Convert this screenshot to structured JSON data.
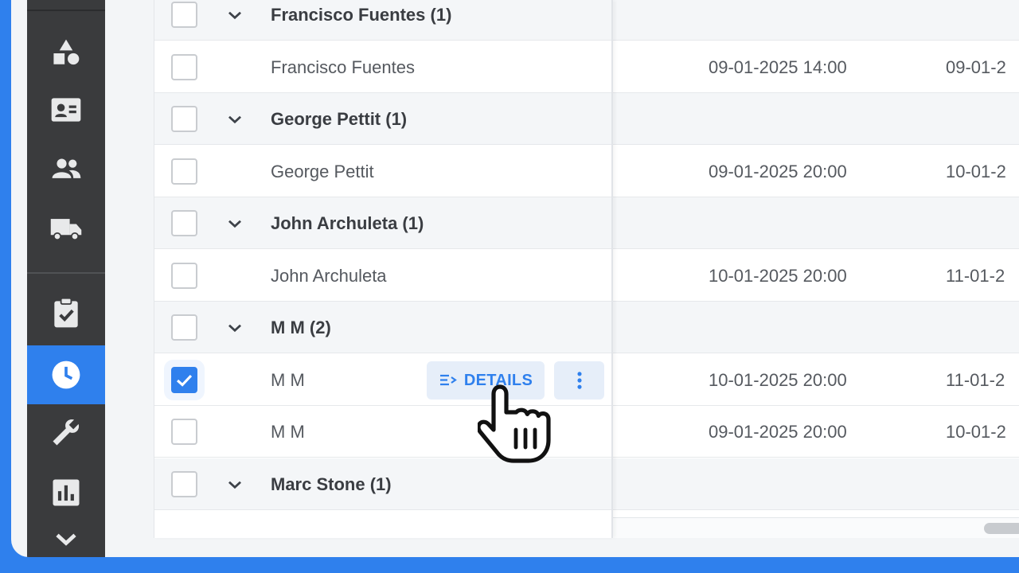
{
  "sidebar": {
    "items": [
      {
        "icon": "shapes-icon",
        "active": false
      },
      {
        "icon": "contact-card-icon",
        "active": false
      },
      {
        "icon": "people-icon",
        "active": false
      },
      {
        "icon": "truck-icon",
        "active": false
      },
      {
        "icon": "clipboard-check-icon",
        "active": false
      },
      {
        "icon": "clock-icon",
        "active": true
      },
      {
        "icon": "wrench-icon",
        "active": false
      },
      {
        "icon": "bar-chart-icon",
        "active": false
      },
      {
        "icon": "chevron-down-icon",
        "active": false
      }
    ]
  },
  "colors": {
    "accent": "#2f80ed",
    "sidebar": "#3a3b3d"
  },
  "rows": [
    {
      "type": "group",
      "name": "Francisco Fuentes (1)",
      "checked": false
    },
    {
      "type": "item",
      "name": "Francisco Fuentes",
      "start": "09-01-2025 14:00",
      "end": "09-01-2",
      "checked": false
    },
    {
      "type": "group",
      "name": "George Pettit (1)",
      "checked": false
    },
    {
      "type": "item",
      "name": "George Pettit",
      "start": "09-01-2025 20:00",
      "end": "10-01-2",
      "checked": false
    },
    {
      "type": "group",
      "name": "John Archuleta (1)",
      "checked": false
    },
    {
      "type": "item",
      "name": "John Archuleta",
      "start": "10-01-2025 20:00",
      "end": "11-01-2",
      "checked": false
    },
    {
      "type": "group",
      "name": "M M (2)",
      "checked": false
    },
    {
      "type": "item",
      "name": "M M",
      "start": "10-01-2025 20:00",
      "end": "11-01-2",
      "checked": true
    },
    {
      "type": "item",
      "name": "M M",
      "start": "09-01-2025 20:00",
      "end": "10-01-2",
      "checked": false
    },
    {
      "type": "group",
      "name": "Marc Stone (1)",
      "checked": false
    }
  ],
  "actions": {
    "details_label": "DETAILS"
  }
}
